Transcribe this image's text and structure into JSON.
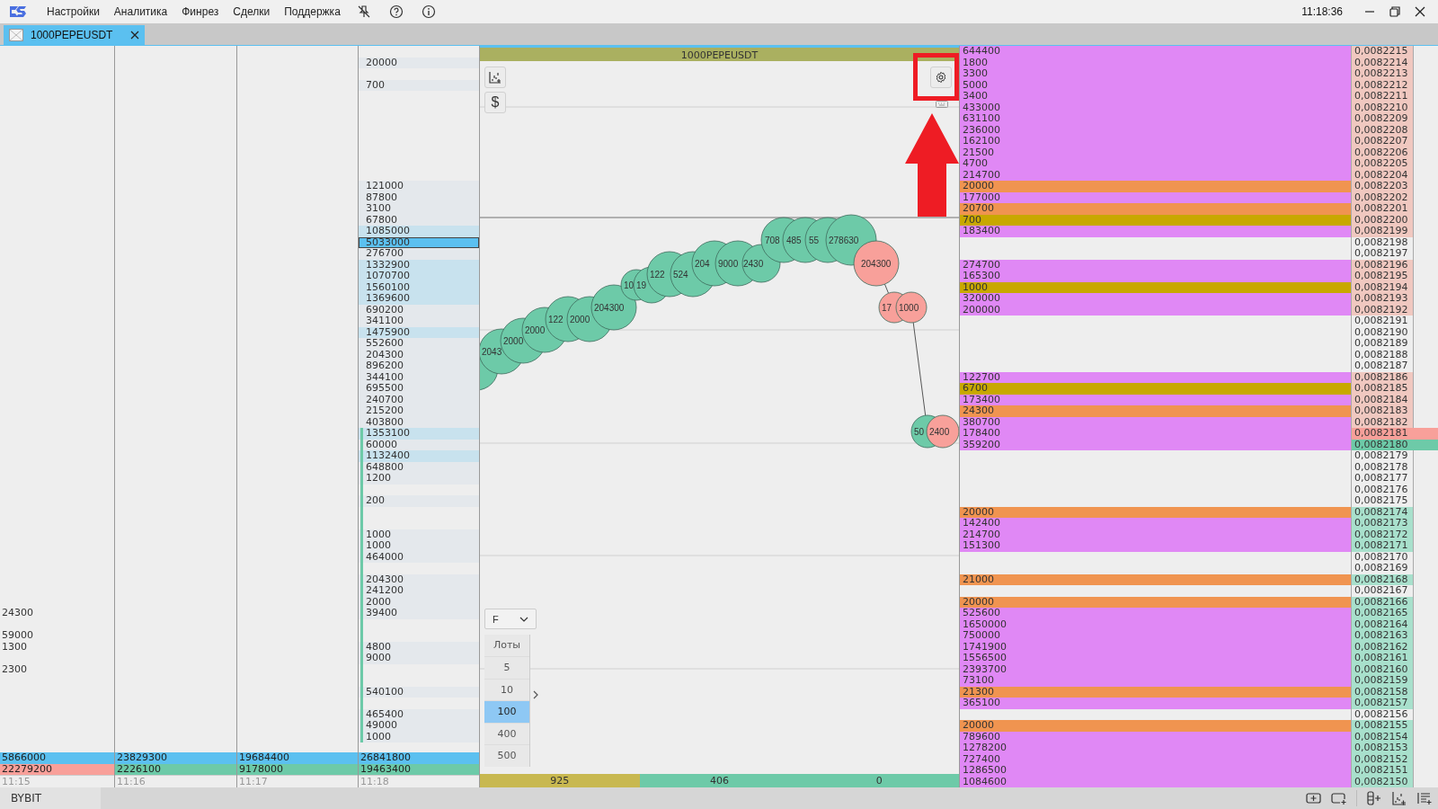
{
  "menu": [
    "Настройки",
    "Аналитика",
    "Финрез",
    "Сделки",
    "Поддержка"
  ],
  "clock": "11:18:36",
  "tabs": [
    {
      "label": "1000PEPEUSDT",
      "selected": true
    }
  ],
  "time_columns": [
    {
      "cells": [
        null,
        null,
        null,
        null,
        null,
        null,
        null,
        null,
        null,
        null,
        null,
        null,
        null,
        null,
        null,
        null,
        null,
        null,
        null,
        null,
        null,
        null,
        null,
        null,
        null,
        null,
        null,
        null,
        null,
        null,
        null,
        null,
        null,
        null,
        null,
        null,
        null,
        null,
        null,
        null,
        null,
        null,
        null,
        null,
        null,
        null,
        null,
        null,
        null,
        null,
        "24300",
        null,
        "59000",
        "1300",
        null,
        "2300",
        null,
        null,
        null,
        null,
        null,
        null
      ],
      "totals": [
        {
          "value": "5866000",
          "color": "#5bc0f0"
        },
        {
          "value": "22279200",
          "color": "#f8a09a"
        }
      ],
      "time": "11:15"
    },
    {
      "totals": [
        {
          "value": "23829300",
          "color": "#5bc0f0"
        },
        {
          "value": "2226100",
          "color": "#6dcaa8"
        }
      ],
      "time": "11:16"
    },
    {
      "totals": [
        {
          "value": "19684400",
          "color": "#5bc0f0"
        },
        {
          "value": "9178000",
          "color": "#6dcaa8"
        }
      ],
      "time": "11:17"
    }
  ],
  "profile_column": {
    "cells": [
      null,
      {
        "value": "20000",
        "shaded": false,
        "selected": false
      },
      null,
      {
        "value": "700",
        "shaded": false,
        "selected": false
      },
      null,
      null,
      null,
      null,
      null,
      null,
      null,
      null,
      {
        "value": "121000",
        "shaded": false,
        "selected": false
      },
      {
        "value": "87800",
        "shaded": false,
        "selected": false
      },
      {
        "value": "3100",
        "shaded": false,
        "selected": false
      },
      {
        "value": "67800",
        "shaded": false,
        "selected": false
      },
      {
        "value": "1085000",
        "shaded": true,
        "selected": false
      },
      {
        "value": "5033000",
        "shaded": false,
        "selected": true
      },
      {
        "value": "276700",
        "shaded": false,
        "selected": false
      },
      {
        "value": "1332900",
        "shaded": true,
        "selected": false
      },
      {
        "value": "1070700",
        "shaded": true,
        "selected": false
      },
      {
        "value": "1560100",
        "shaded": true,
        "selected": false
      },
      {
        "value": "1369600",
        "shaded": true,
        "selected": false
      },
      {
        "value": "690200",
        "shaded": false,
        "selected": false
      },
      {
        "value": "341100",
        "shaded": false,
        "selected": false
      },
      {
        "value": "1475900",
        "shaded": true,
        "selected": false
      },
      {
        "value": "552600",
        "shaded": false,
        "selected": false
      },
      {
        "value": "204300",
        "shaded": false,
        "selected": false
      },
      {
        "value": "896200",
        "shaded": false,
        "selected": false
      },
      {
        "value": "344100",
        "shaded": false,
        "selected": false
      },
      {
        "value": "695500",
        "shaded": false,
        "selected": false
      },
      {
        "value": "240700",
        "shaded": false,
        "selected": false
      },
      {
        "value": "215200",
        "shaded": false,
        "selected": false
      },
      {
        "value": "403800",
        "shaded": false,
        "selected": false
      },
      {
        "value": "1353100",
        "shaded": true,
        "selected": false
      },
      {
        "value": "60000",
        "shaded": false,
        "selected": false
      },
      {
        "value": "1132400",
        "shaded": true,
        "selected": false
      },
      {
        "value": "648800",
        "shaded": false,
        "selected": false
      },
      {
        "value": "1200",
        "shaded": false,
        "selected": false
      },
      null,
      {
        "value": "200",
        "shaded": false,
        "selected": false
      },
      null,
      null,
      {
        "value": "1000",
        "shaded": false,
        "selected": false
      },
      {
        "value": "1000",
        "shaded": false,
        "selected": false
      },
      {
        "value": "464000",
        "shaded": false,
        "selected": false
      },
      null,
      {
        "value": "204300",
        "shaded": false,
        "selected": false
      },
      {
        "value": "241200",
        "shaded": false,
        "selected": false
      },
      {
        "value": "2000",
        "shaded": false,
        "selected": false
      },
      {
        "value": "39400",
        "shaded": false,
        "selected": false
      },
      null,
      null,
      {
        "value": "4800",
        "shaded": false,
        "selected": false
      },
      {
        "value": "9000",
        "shaded": false,
        "selected": false
      },
      null,
      null,
      {
        "value": "540100",
        "shaded": false,
        "selected": false
      },
      null,
      {
        "value": "465400",
        "shaded": false,
        "selected": false
      },
      {
        "value": "49000",
        "shaded": false,
        "selected": false
      },
      {
        "value": "1000",
        "shaded": false,
        "selected": false
      }
    ],
    "totals": [
      {
        "value": "26841800",
        "color": "#5bc0f0"
      },
      {
        "value": "19463400",
        "color": "#6dcaa8"
      }
    ],
    "time": "11:18"
  },
  "chart": {
    "title": "1000PEPEUSDT",
    "currency_button": "$",
    "bubbles": [
      {
        "color": "#6dcaa8"
      },
      {
        "label": "2043",
        "color": "#6dcaa8"
      },
      {
        "label": "2000",
        "color": "#6dcaa8"
      },
      {
        "label": "2000",
        "color": "#6dcaa8"
      },
      {
        "label": "122",
        "color": "#6dcaa8"
      },
      {
        "label": "2000",
        "color": "#6dcaa8"
      },
      {
        "label": "204300",
        "color": "#6dcaa8"
      },
      {
        "label": "10",
        "color": "#6dcaa8"
      },
      {
        "label": "19",
        "color": "#6dcaa8"
      },
      {
        "label": "122",
        "color": "#6dcaa8"
      },
      {
        "label": "524",
        "color": "#6dcaa8"
      },
      {
        "label": "204",
        "color": "#6dcaa8"
      },
      {
        "label": "9000",
        "color": "#6dcaa8"
      },
      {
        "label": "2430",
        "color": "#6dcaa8"
      },
      {
        "label": "708",
        "color": "#6dcaa8"
      },
      {
        "label": "485",
        "color": "#6dcaa8"
      },
      {
        "label": "55",
        "color": "#6dcaa8"
      },
      {
        "label": "278630",
        "color": "#6dcaa8"
      },
      {
        "label": "204300",
        "color": "#f8a09a"
      },
      {
        "label": "17",
        "color": "#f8a09a"
      },
      {
        "label": "1000",
        "color": "#f8a09a"
      },
      {
        "label": "50",
        "color": "#6dcaa8"
      },
      {
        "label": "2400",
        "color": "#f8a09a"
      }
    ],
    "mode_select": {
      "value": "F"
    },
    "lots": {
      "title": "Лоты",
      "options": [
        {
          "label": "5",
          "selected": false
        },
        {
          "label": "10",
          "selected": false
        },
        {
          "label": "100",
          "selected": true
        },
        {
          "label": "400",
          "selected": false
        },
        {
          "label": "500",
          "selected": false
        }
      ]
    },
    "footer": [
      {
        "value": "925",
        "color": "#c8b850"
      },
      {
        "value": "406",
        "color": "#6dcaa8"
      },
      {
        "value": "0",
        "color": "#6dcaa8"
      }
    ]
  },
  "book": {
    "rows": [
      {
        "size": {
          "value": "644400",
          "color": "#e088f5"
        },
        "price": {
          "value": "0,0082215",
          "color": "#f0c8c0"
        },
        "highlight": false
      },
      {
        "size": {
          "value": "1800",
          "color": "#e088f5"
        },
        "price": {
          "value": "0,0082214",
          "color": "#f0c8c0"
        },
        "highlight": false
      },
      {
        "size": {
          "value": "3300",
          "color": "#e088f5"
        },
        "price": {
          "value": "0,0082213",
          "color": "#f0c8c0"
        },
        "highlight": false
      },
      {
        "size": {
          "value": "5000",
          "color": "#e088f5"
        },
        "price": {
          "value": "0,0082212",
          "color": "#f0c8c0"
        },
        "highlight": false
      },
      {
        "size": {
          "value": "3400",
          "color": "#e088f5"
        },
        "price": {
          "value": "0,0082211",
          "color": "#f0c8c0"
        },
        "highlight": false
      },
      {
        "size": {
          "value": "433000",
          "color": "#e088f5"
        },
        "price": {
          "value": "0,0082210",
          "color": "#f0c8c0"
        },
        "highlight": false
      },
      {
        "size": {
          "value": "631100",
          "color": "#e088f5"
        },
        "price": {
          "value": "0,0082209",
          "color": "#f0c8c0"
        },
        "highlight": false
      },
      {
        "size": {
          "value": "236000",
          "color": "#e088f5"
        },
        "price": {
          "value": "0,0082208",
          "color": "#f0c8c0"
        },
        "highlight": false
      },
      {
        "size": {
          "value": "162100",
          "color": "#e088f5"
        },
        "price": {
          "value": "0,0082207",
          "color": "#f0c8c0"
        },
        "highlight": false
      },
      {
        "size": {
          "value": "21500",
          "color": "#e088f5"
        },
        "price": {
          "value": "0,0082206",
          "color": "#f0c8c0"
        },
        "highlight": false
      },
      {
        "size": {
          "value": "4700",
          "color": "#e088f5"
        },
        "price": {
          "value": "0,0082205",
          "color": "#f0c8c0"
        },
        "highlight": false
      },
      {
        "size": {
          "value": "214700",
          "color": "#e088f5"
        },
        "price": {
          "value": "0,0082204",
          "color": "#f0c8c0"
        },
        "highlight": false
      },
      {
        "size": {
          "value": "20000",
          "color": "#f09450"
        },
        "price": {
          "value": "0,0082203",
          "color": "#f0c8c0"
        },
        "highlight": false
      },
      {
        "size": {
          "value": "177000",
          "color": "#e088f5"
        },
        "price": {
          "value": "0,0082202",
          "color": "#f0c8c0"
        },
        "highlight": false
      },
      {
        "size": {
          "value": "20700",
          "color": "#f09450"
        },
        "price": {
          "value": "0,0082201",
          "color": "#f0c8c0"
        },
        "highlight": false
      },
      {
        "size": {
          "value": "700",
          "color": "#c8a800"
        },
        "price": {
          "value": "0,0082200",
          "color": "#f0c8c0"
        },
        "highlight": false
      },
      {
        "size": {
          "value": "183400",
          "color": "#e088f5"
        },
        "price": {
          "value": "0,0082199",
          "color": "#f0c8c0"
        },
        "highlight": false
      },
      {
        "price": {
          "value": "0,0082198"
        },
        "highlight": false
      },
      {
        "price": {
          "value": "0,0082197"
        },
        "highlight": false
      },
      {
        "size": {
          "value": "274700",
          "color": "#e088f5"
        },
        "price": {
          "value": "0,0082196",
          "color": "#f0c8c0"
        },
        "highlight": false
      },
      {
        "size": {
          "value": "165300",
          "color": "#e088f5"
        },
        "price": {
          "value": "0,0082195",
          "color": "#f0c8c0"
        },
        "highlight": false
      },
      {
        "size": {
          "value": "1000",
          "color": "#c8a800"
        },
        "price": {
          "value": "0,0082194",
          "color": "#f0c8c0"
        },
        "highlight": false
      },
      {
        "size": {
          "value": "320000",
          "color": "#e088f5"
        },
        "price": {
          "value": "0,0082193",
          "color": "#f0c8c0"
        },
        "highlight": false
      },
      {
        "size": {
          "value": "200000",
          "color": "#e088f5"
        },
        "price": {
          "value": "0,0082192",
          "color": "#f0c8c0"
        },
        "highlight": false
      },
      {
        "price": {
          "value": "0,0082191"
        },
        "highlight": false
      },
      {
        "price": {
          "value": "0,0082190"
        },
        "highlight": false
      },
      {
        "price": {
          "value": "0,0082189"
        },
        "highlight": false
      },
      {
        "price": {
          "value": "0,0082188"
        },
        "highlight": false
      },
      {
        "price": {
          "value": "0,0082187"
        },
        "highlight": false
      },
      {
        "size": {
          "value": "122700",
          "color": "#e088f5"
        },
        "price": {
          "value": "0,0082186",
          "color": "#f0c8c0"
        },
        "highlight": false
      },
      {
        "size": {
          "value": "6700",
          "color": "#c8a800"
        },
        "price": {
          "value": "0,0082185",
          "color": "#f0c8c0"
        },
        "highlight": false
      },
      {
        "size": {
          "value": "173400",
          "color": "#e088f5"
        },
        "price": {
          "value": "0,0082184",
          "color": "#f0c8c0"
        },
        "highlight": false
      },
      {
        "size": {
          "value": "24300",
          "color": "#f09450"
        },
        "price": {
          "value": "0,0082183",
          "color": "#f0c8c0"
        },
        "highlight": false
      },
      {
        "size": {
          "value": "380700",
          "color": "#e088f5"
        },
        "price": {
          "value": "0,0082182",
          "color": "#f0c8c0"
        },
        "highlight": false
      },
      {
        "size": {
          "value": "178400",
          "color": "#e088f5"
        },
        "price": {
          "value": "0,0082181",
          "color": "#f8a09a"
        },
        "highlight": true
      },
      {
        "size": {
          "value": "359200",
          "color": "#e088f5"
        },
        "price": {
          "value": "0,0082180",
          "color": "#6dcaa8"
        },
        "highlight": true
      },
      {
        "price": {
          "value": "0,0082179"
        },
        "highlight": false
      },
      {
        "price": {
          "value": "0,0082178"
        },
        "highlight": false
      },
      {
        "price": {
          "value": "0,0082177"
        },
        "highlight": false
      },
      {
        "price": {
          "value": "0,0082176"
        },
        "highlight": false
      },
      {
        "price": {
          "value": "0,0082175"
        },
        "highlight": false
      },
      {
        "size": {
          "value": "20000",
          "color": "#f09450"
        },
        "price": {
          "value": "0,0082174",
          "color": "#a8e0cc"
        },
        "highlight": false
      },
      {
        "size": {
          "value": "142400",
          "color": "#e088f5"
        },
        "price": {
          "value": "0,0082173",
          "color": "#a8e0cc"
        },
        "highlight": false
      },
      {
        "size": {
          "value": "214700",
          "color": "#e088f5"
        },
        "price": {
          "value": "0,0082172",
          "color": "#a8e0cc"
        },
        "highlight": false
      },
      {
        "size": {
          "value": "151300",
          "color": "#e088f5"
        },
        "price": {
          "value": "0,0082171",
          "color": "#a8e0cc"
        },
        "highlight": false
      },
      {
        "price": {
          "value": "0,0082170"
        },
        "highlight": false
      },
      {
        "price": {
          "value": "0,0082169"
        },
        "highlight": false
      },
      {
        "size": {
          "value": "21000",
          "color": "#f09450"
        },
        "price": {
          "value": "0,0082168",
          "color": "#a8e0cc"
        },
        "highlight": false
      },
      {
        "price": {
          "value": "0,0082167"
        },
        "highlight": false
      },
      {
        "size": {
          "value": "20000",
          "color": "#f09450"
        },
        "price": {
          "value": "0,0082166",
          "color": "#a8e0cc"
        },
        "highlight": false
      },
      {
        "size": {
          "value": "525600",
          "color": "#e088f5"
        },
        "price": {
          "value": "0,0082165",
          "color": "#a8e0cc"
        },
        "highlight": false
      },
      {
        "size": {
          "value": "1650000",
          "color": "#e088f5"
        },
        "price": {
          "value": "0,0082164",
          "color": "#a8e0cc"
        },
        "highlight": false
      },
      {
        "size": {
          "value": "750000",
          "color": "#e088f5"
        },
        "price": {
          "value": "0,0082163",
          "color": "#a8e0cc"
        },
        "highlight": false
      },
      {
        "size": {
          "value": "1741900",
          "color": "#e088f5"
        },
        "price": {
          "value": "0,0082162",
          "color": "#a8e0cc"
        },
        "highlight": false
      },
      {
        "size": {
          "value": "1556500",
          "color": "#e088f5"
        },
        "price": {
          "value": "0,0082161",
          "color": "#a8e0cc"
        },
        "highlight": false
      },
      {
        "size": {
          "value": "2393700",
          "color": "#e088f5"
        },
        "price": {
          "value": "0,0082160",
          "color": "#a8e0cc"
        },
        "highlight": false
      },
      {
        "size": {
          "value": "73100",
          "color": "#e088f5"
        },
        "price": {
          "value": "0,0082159",
          "color": "#a8e0cc"
        },
        "highlight": false
      },
      {
        "size": {
          "value": "21300",
          "color": "#f09450"
        },
        "price": {
          "value": "0,0082158",
          "color": "#a8e0cc"
        },
        "highlight": false
      },
      {
        "size": {
          "value": "365100",
          "color": "#e088f5"
        },
        "price": {
          "value": "0,0082157",
          "color": "#a8e0cc"
        },
        "highlight": false
      },
      {
        "price": {
          "value": "0,0082156"
        },
        "highlight": false
      },
      {
        "size": {
          "value": "20000",
          "color": "#f09450"
        },
        "price": {
          "value": "0,0082155",
          "color": "#a8e0cc"
        },
        "highlight": false
      },
      {
        "size": {
          "value": "789600",
          "color": "#e088f5"
        },
        "price": {
          "value": "0,0082154",
          "color": "#a8e0cc"
        },
        "highlight": false
      },
      {
        "size": {
          "value": "1278200",
          "color": "#e088f5"
        },
        "price": {
          "value": "0,0082153",
          "color": "#a8e0cc"
        },
        "highlight": false
      },
      {
        "size": {
          "value": "727400",
          "color": "#e088f5"
        },
        "price": {
          "value": "0,0082152",
          "color": "#a8e0cc"
        },
        "highlight": false
      },
      {
        "size": {
          "value": "1286500",
          "color": "#e088f5"
        },
        "price": {
          "value": "0,0082151",
          "color": "#a8e0cc"
        },
        "highlight": false
      },
      {
        "size": {
          "value": "1084600",
          "color": "#e088f5"
        },
        "price": {
          "value": "0,0082150",
          "color": "#a8e0cc"
        },
        "highlight": false
      }
    ]
  },
  "status_bar": {
    "exchange": "BYBIT"
  }
}
